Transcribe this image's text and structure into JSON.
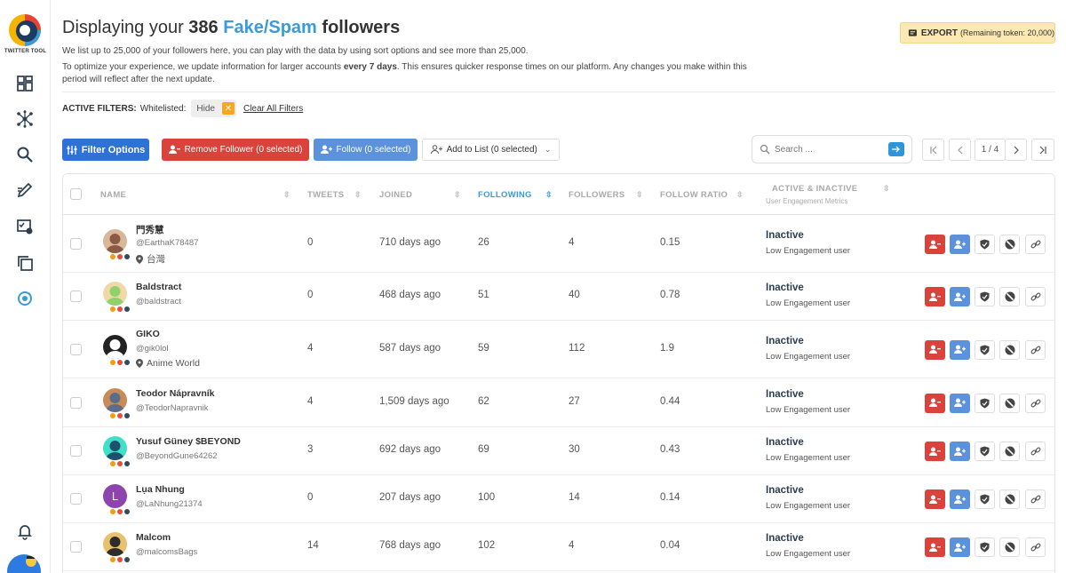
{
  "sidebar": {
    "logo_text": "TWITTER TOOL",
    "icons": [
      "dashboard-icon",
      "network-icon",
      "search-icon",
      "edit-icon",
      "checklist-icon",
      "copy-icon",
      "refresh-icon",
      "bell-icon"
    ]
  },
  "header": {
    "title_prefix": "Displaying your",
    "title_count": "386",
    "title_type": "Fake/Spam",
    "title_suffix": "followers",
    "desc1": "We list up to 25,000 of your followers here, you can play with the data by using sort options and see more than 25,000.",
    "desc2a": "To optimize your experience, we update information for larger accounts",
    "desc2b": "every 7 days",
    "desc2c": ". This ensures quicker response times on our platform. Any changes you make within this period will reflect after the next update.",
    "export_label": "EXPORT",
    "export_remaining": "(Remaining token: 20,000)"
  },
  "filters": {
    "label": "ACTIVE FILTERS:",
    "whitelisted": "Whitelisted:",
    "chip": "Hide",
    "clear": "Clear All Filters"
  },
  "toolbar": {
    "filter_options": "Filter Options",
    "remove_follower": "Remove Follower (0 selected)",
    "follow": "Follow (0 selected)",
    "add_to_list": "Add to List (0 selected)",
    "search_placeholder": "Search ...",
    "page": "1 / 4"
  },
  "table": {
    "columns": {
      "name": "NAME",
      "tweets": "TWEETS",
      "joined": "JOINED",
      "following": "FOLLOWING",
      "followers": "FOLLOWERS",
      "ratio": "FOLLOW RATIO",
      "active": "ACTIVE & INACTIVE",
      "active_sub": "User Engagement Metrics"
    },
    "rows": [
      {
        "name": "門秀慧",
        "handle": "@EarthaK78487",
        "location": "台灣",
        "tweets": "0",
        "joined": "710 days ago",
        "following": "26",
        "followers": "4",
        "ratio": "0.15",
        "status": "Inactive",
        "engagement": "Low Engagement user"
      },
      {
        "name": "Baldstract",
        "handle": "@baldstract",
        "location": "",
        "tweets": "0",
        "joined": "468 days ago",
        "following": "51",
        "followers": "40",
        "ratio": "0.78",
        "status": "Inactive",
        "engagement": "Low Engagement user"
      },
      {
        "name": "GIKO",
        "handle": "@gik0lol",
        "location": "Anime World",
        "tweets": "4",
        "joined": "587 days ago",
        "following": "59",
        "followers": "112",
        "ratio": "1.9",
        "status": "Inactive",
        "engagement": "Low Engagement user"
      },
      {
        "name": "Teodor Nápravník",
        "handle": "@TeodorNapravnik",
        "location": "",
        "tweets": "4",
        "joined": "1,509 days ago",
        "following": "62",
        "followers": "27",
        "ratio": "0.44",
        "status": "Inactive",
        "engagement": "Low Engagement user"
      },
      {
        "name": "Yusuf Güney $BEYOND",
        "handle": "@BeyondGune64262",
        "location": "",
        "tweets": "3",
        "joined": "692 days ago",
        "following": "69",
        "followers": "30",
        "ratio": "0.43",
        "status": "Inactive",
        "engagement": "Low Engagement user"
      },
      {
        "name": "Lụa Nhung",
        "handle": "@LaNhung21374",
        "location": "",
        "tweets": "0",
        "joined": "207 days ago",
        "following": "100",
        "followers": "14",
        "ratio": "0.14",
        "status": "Inactive",
        "engagement": "Low Engagement user"
      },
      {
        "name": "Malcom",
        "handle": "@malcomsBags",
        "location": "",
        "tweets": "14",
        "joined": "768 days ago",
        "following": "102",
        "followers": "4",
        "ratio": "0.04",
        "status": "Inactive",
        "engagement": "Low Engagement user"
      }
    ],
    "avatar_letter": "L"
  },
  "colors": {
    "accent": "#3b9ad9",
    "danger": "#d9433c",
    "follow": "#5b92db",
    "primary": "#2f72d6",
    "export_bg": "#fbe8b2"
  }
}
